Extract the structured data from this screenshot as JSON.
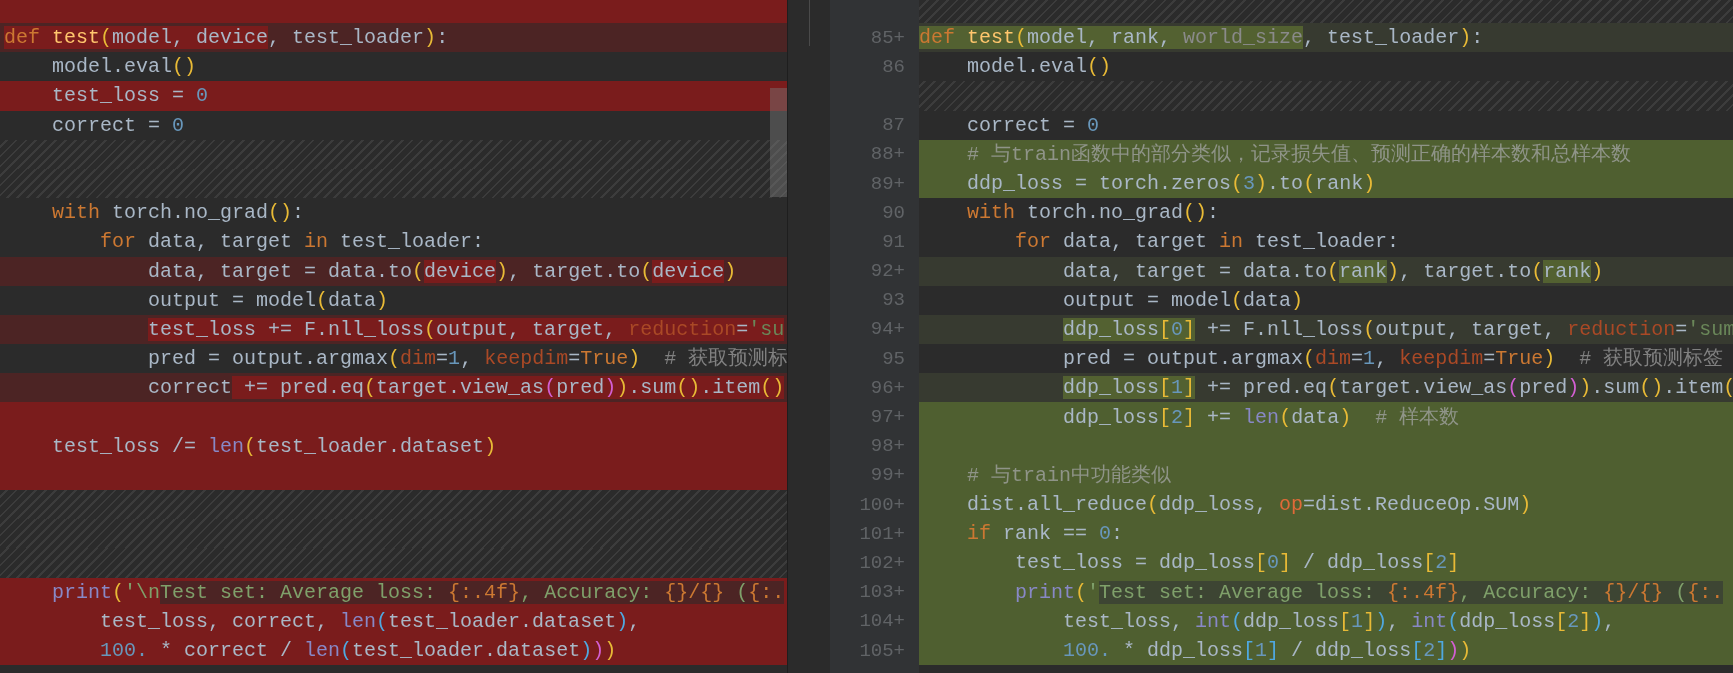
{
  "left_pane": {
    "rows": [
      {
        "kind": "deleted"
      },
      {
        "kind": "modified",
        "parts": [
          {
            "changed": true,
            "tokens": [
              {
                "text": "def ",
                "kind": "kw"
              },
              {
                "text": "test",
                "kind": "fn"
              },
              {
                "text": "(",
                "kind": "b1"
              },
              {
                "text": "model, device",
                "kind": "p"
              }
            ]
          },
          {
            "changed": false,
            "tokens": [
              {
                "text": ", test_loader",
                "kind": "p"
              },
              {
                "text": ")",
                "kind": "b1"
              },
              {
                "text": ":",
                "kind": "p"
              }
            ]
          }
        ]
      },
      {
        "kind": "unchanged",
        "tokens": [
          {
            "text": "    model.eval",
            "kind": "p"
          },
          {
            "text": "()",
            "kind": "b1"
          }
        ]
      },
      {
        "kind": "deleted",
        "tokens": [
          {
            "text": "    test_loss = ",
            "kind": "p"
          },
          {
            "text": "0",
            "kind": "num"
          }
        ]
      },
      {
        "kind": "unchanged",
        "tokens": [
          {
            "text": "    correct = ",
            "kind": "p"
          },
          {
            "text": "0",
            "kind": "num"
          }
        ]
      },
      {
        "kind": "gap"
      },
      {
        "kind": "gap"
      },
      {
        "kind": "unchanged",
        "tokens": [
          {
            "text": "    with",
            "kind": "kw"
          },
          {
            "text": " torch.no_grad",
            "kind": "p"
          },
          {
            "text": "()",
            "kind": "b1"
          },
          {
            "text": ":",
            "kind": "p"
          }
        ]
      },
      {
        "kind": "unchanged",
        "tokens": [
          {
            "text": "        for",
            "kind": "kw"
          },
          {
            "text": " data, target ",
            "kind": "p"
          },
          {
            "text": "in",
            "kind": "kw"
          },
          {
            "text": " test_loader:",
            "kind": "p"
          }
        ]
      },
      {
        "kind": "modified",
        "parts": [
          {
            "changed": false,
            "tokens": [
              {
                "text": "            data, target = data.to",
                "kind": "p"
              },
              {
                "text": "(",
                "kind": "b1"
              }
            ]
          },
          {
            "changed": true,
            "tokens": [
              {
                "text": "device",
                "kind": "p"
              }
            ]
          },
          {
            "changed": false,
            "tokens": [
              {
                "text": ")",
                "kind": "b1"
              },
              {
                "text": ", target.to",
                "kind": "p"
              },
              {
                "text": "(",
                "kind": "b1"
              }
            ]
          },
          {
            "changed": true,
            "tokens": [
              {
                "text": "device",
                "kind": "p"
              }
            ]
          },
          {
            "changed": false,
            "tokens": [
              {
                "text": ")",
                "kind": "b1"
              }
            ]
          }
        ]
      },
      {
        "kind": "unchanged",
        "tokens": [
          {
            "text": "            output = model",
            "kind": "p"
          },
          {
            "text": "(",
            "kind": "b1"
          },
          {
            "text": "data",
            "kind": "p"
          },
          {
            "text": ")",
            "kind": "b1"
          }
        ]
      },
      {
        "kind": "modified",
        "parts": [
          {
            "changed": true,
            "tokens": [
              {
                "text": "            test_loss += F.nll_loss",
                "kind": "p"
              },
              {
                "text": "(",
                "kind": "b1"
              },
              {
                "text": "output, target, ",
                "kind": "p"
              },
              {
                "text": "reduction",
                "kind": "arg"
              },
              {
                "text": "=",
                "kind": "p"
              },
              {
                "text": "'su",
                "kind": "str"
              }
            ]
          }
        ]
      },
      {
        "kind": "unchanged",
        "tokens": [
          {
            "text": "            pred = output.argmax",
            "kind": "p"
          },
          {
            "text": "(",
            "kind": "b1"
          },
          {
            "text": "dim",
            "kind": "arg"
          },
          {
            "text": "=",
            "kind": "p"
          },
          {
            "text": "1",
            "kind": "num"
          },
          {
            "text": ", ",
            "kind": "p"
          },
          {
            "text": "keepdim",
            "kind": "arg"
          },
          {
            "text": "=",
            "kind": "p"
          },
          {
            "text": "True",
            "kind": "kw"
          },
          {
            "text": ")",
            "kind": "b1"
          },
          {
            "text": "  # 获取预测标",
            "kind": "com"
          }
        ]
      },
      {
        "kind": "modified",
        "parts": [
          {
            "changed": false,
            "tokens": [
              {
                "text": "            correct",
                "kind": "p"
              }
            ]
          },
          {
            "changed": true,
            "tokens": [
              {
                "text": " += pred.eq",
                "kind": "p"
              },
              {
                "text": "(",
                "kind": "b1"
              },
              {
                "text": "target.view_as",
                "kind": "p"
              },
              {
                "text": "(",
                "kind": "b2"
              },
              {
                "text": "pred",
                "kind": "p"
              },
              {
                "text": ")",
                "kind": "b2"
              },
              {
                "text": ")",
                "kind": "b1"
              },
              {
                "text": ".sum",
                "kind": "p"
              },
              {
                "text": "()",
                "kind": "b1"
              },
              {
                "text": ".item",
                "kind": "p"
              },
              {
                "text": "()",
                "kind": "b1"
              }
            ]
          }
        ]
      },
      {
        "kind": "deleted"
      },
      {
        "kind": "deleted",
        "tokens": [
          {
            "text": "    test_loss /= ",
            "kind": "p"
          },
          {
            "text": "len",
            "kind": "bi"
          },
          {
            "text": "(",
            "kind": "b1"
          },
          {
            "text": "test_loader.dataset",
            "kind": "p"
          },
          {
            "text": ")",
            "kind": "b1"
          }
        ]
      },
      {
        "kind": "deleted"
      },
      {
        "kind": "gap"
      },
      {
        "kind": "gap"
      },
      {
        "kind": "gap"
      },
      {
        "kind": "deleted",
        "parts": [
          {
            "changed": false,
            "tokens": [
              {
                "text": "    print",
                "kind": "bi"
              },
              {
                "text": "(",
                "kind": "b1"
              },
              {
                "text": "'\\n",
                "kind": "str"
              }
            ]
          },
          {
            "changed": true,
            "tokens": [
              {
                "text": "Test set: Average loss: ",
                "kind": "str"
              },
              {
                "text": "{:.4f}",
                "kind": "fmt"
              },
              {
                "text": ", Accuracy: ",
                "kind": "str"
              },
              {
                "text": "{}/{}",
                "kind": "fmt"
              },
              {
                "text": " (",
                "kind": "str"
              },
              {
                "text": "{:.",
                "kind": "fmt"
              }
            ]
          }
        ]
      },
      {
        "kind": "deleted",
        "tokens": [
          {
            "text": "        test_loss, correct, ",
            "kind": "p"
          },
          {
            "text": "len",
            "kind": "bi"
          },
          {
            "text": "(",
            "kind": "b3"
          },
          {
            "text": "test_loader.dataset",
            "kind": "p"
          },
          {
            "text": ")",
            "kind": "b3"
          },
          {
            "text": ",",
            "kind": "p"
          }
        ]
      },
      {
        "kind": "deleted",
        "tokens": [
          {
            "text": "        100.",
            "kind": "num"
          },
          {
            "text": " * correct / ",
            "kind": "p"
          },
          {
            "text": "len",
            "kind": "bi"
          },
          {
            "text": "(",
            "kind": "b3"
          },
          {
            "text": "test_loader.dataset",
            "kind": "p"
          },
          {
            "text": ")",
            "kind": "b3"
          },
          {
            "text": ")",
            "kind": "b2"
          },
          {
            "text": ")",
            "kind": "b1"
          }
        ]
      }
    ]
  },
  "right_pane": {
    "rows": [
      {
        "kind": "gap"
      },
      {
        "kind": "modified",
        "number": "85+",
        "parts": [
          {
            "changed": true,
            "tokens": [
              {
                "text": "def ",
                "kind": "kw"
              },
              {
                "text": "test",
                "kind": "fn"
              },
              {
                "text": "(",
                "kind": "b1"
              },
              {
                "text": "model, rank, ",
                "kind": "p"
              },
              {
                "text": "world_size",
                "kind": "unused"
              }
            ]
          },
          {
            "changed": false,
            "tokens": [
              {
                "text": ", test_loader",
                "kind": "p"
              },
              {
                "text": ")",
                "kind": "b1"
              },
              {
                "text": ":",
                "kind": "p"
              }
            ]
          }
        ]
      },
      {
        "kind": "unchanged",
        "number": "86",
        "tokens": [
          {
            "text": "    model.eval",
            "kind": "p"
          },
          {
            "text": "()",
            "kind": "b1"
          }
        ]
      },
      {
        "kind": "gap"
      },
      {
        "kind": "unchanged",
        "number": "87",
        "tokens": [
          {
            "text": "    correct = ",
            "kind": "p"
          },
          {
            "text": "0",
            "kind": "num"
          }
        ]
      },
      {
        "kind": "inserted",
        "number": "88+",
        "tokens": [
          {
            "text": "    # 与train函数中的部分类似，记录损失值、预测正确的样本数和总样本数",
            "kind": "com"
          }
        ]
      },
      {
        "kind": "inserted",
        "number": "89+",
        "tokens": [
          {
            "text": "    ddp_loss = torch.zeros",
            "kind": "p"
          },
          {
            "text": "(",
            "kind": "b1"
          },
          {
            "text": "3",
            "kind": "num"
          },
          {
            "text": ")",
            "kind": "b1"
          },
          {
            "text": ".to",
            "kind": "p"
          },
          {
            "text": "(",
            "kind": "b1"
          },
          {
            "text": "rank",
            "kind": "p"
          },
          {
            "text": ")",
            "kind": "b1"
          }
        ]
      },
      {
        "kind": "unchanged",
        "number": "90",
        "tokens": [
          {
            "text": "    with",
            "kind": "kw"
          },
          {
            "text": " torch.no_grad",
            "kind": "p"
          },
          {
            "text": "()",
            "kind": "b1"
          },
          {
            "text": ":",
            "kind": "p"
          }
        ]
      },
      {
        "kind": "unchanged",
        "number": "91",
        "tokens": [
          {
            "text": "        for",
            "kind": "kw"
          },
          {
            "text": " data, target ",
            "kind": "p"
          },
          {
            "text": "in",
            "kind": "kw"
          },
          {
            "text": " test_loader:",
            "kind": "p"
          }
        ]
      },
      {
        "kind": "modified",
        "number": "92+",
        "parts": [
          {
            "changed": false,
            "tokens": [
              {
                "text": "            data, target = data.to",
                "kind": "p"
              },
              {
                "text": "(",
                "kind": "b1"
              }
            ]
          },
          {
            "changed": true,
            "tokens": [
              {
                "text": "rank",
                "kind": "p"
              }
            ]
          },
          {
            "changed": false,
            "tokens": [
              {
                "text": ")",
                "kind": "b1"
              },
              {
                "text": ", target.to",
                "kind": "p"
              },
              {
                "text": "(",
                "kind": "b1"
              }
            ]
          },
          {
            "changed": true,
            "tokens": [
              {
                "text": "rank",
                "kind": "p"
              }
            ]
          },
          {
            "changed": false,
            "tokens": [
              {
                "text": ")",
                "kind": "b1"
              }
            ]
          }
        ]
      },
      {
        "kind": "unchanged",
        "number": "93",
        "tokens": [
          {
            "text": "            output = model",
            "kind": "p"
          },
          {
            "text": "(",
            "kind": "b1"
          },
          {
            "text": "data",
            "kind": "p"
          },
          {
            "text": ")",
            "kind": "b1"
          }
        ]
      },
      {
        "kind": "modified",
        "number": "94+",
        "parts": [
          {
            "changed": true,
            "tokens": [
              {
                "text": "            ddp_loss",
                "kind": "p"
              },
              {
                "text": "[",
                "kind": "b1"
              },
              {
                "text": "0",
                "kind": "num"
              },
              {
                "text": "]",
                "kind": "b1"
              }
            ]
          },
          {
            "changed": false,
            "tokens": [
              {
                "text": " += F.nll_loss",
                "kind": "p"
              },
              {
                "text": "(",
                "kind": "b1"
              },
              {
                "text": "output, target, ",
                "kind": "p"
              },
              {
                "text": "reduction",
                "kind": "arg"
              },
              {
                "text": "=",
                "kind": "p"
              },
              {
                "text": "'sum",
                "kind": "str"
              }
            ]
          }
        ]
      },
      {
        "kind": "unchanged",
        "number": "95",
        "tokens": [
          {
            "text": "            pred = output.argmax",
            "kind": "p"
          },
          {
            "text": "(",
            "kind": "b1"
          },
          {
            "text": "dim",
            "kind": "arg"
          },
          {
            "text": "=",
            "kind": "p"
          },
          {
            "text": "1",
            "kind": "num"
          },
          {
            "text": ", ",
            "kind": "p"
          },
          {
            "text": "keepdim",
            "kind": "arg"
          },
          {
            "text": "=",
            "kind": "p"
          },
          {
            "text": "True",
            "kind": "kw"
          },
          {
            "text": ")",
            "kind": "b1"
          },
          {
            "text": "  # 获取预测标签",
            "kind": "com"
          }
        ]
      },
      {
        "kind": "modified",
        "number": "96+",
        "parts": [
          {
            "changed": true,
            "tokens": [
              {
                "text": "            ddp_loss",
                "kind": "p"
              },
              {
                "text": "[",
                "kind": "b1"
              },
              {
                "text": "1",
                "kind": "num"
              },
              {
                "text": "]",
                "kind": "b1"
              }
            ]
          },
          {
            "changed": false,
            "tokens": [
              {
                "text": " += pred.eq",
                "kind": "p"
              },
              {
                "text": "(",
                "kind": "b1"
              },
              {
                "text": "target.view_as",
                "kind": "p"
              },
              {
                "text": "(",
                "kind": "b2"
              },
              {
                "text": "pred",
                "kind": "p"
              },
              {
                "text": ")",
                "kind": "b2"
              },
              {
                "text": ")",
                "kind": "b1"
              },
              {
                "text": ".sum",
                "kind": "p"
              },
              {
                "text": "()",
                "kind": "b1"
              },
              {
                "text": ".item",
                "kind": "p"
              },
              {
                "text": "(",
                "kind": "b1"
              }
            ]
          }
        ]
      },
      {
        "kind": "inserted",
        "number": "97+",
        "tokens": [
          {
            "text": "            ddp_loss",
            "kind": "p"
          },
          {
            "text": "[",
            "kind": "b1"
          },
          {
            "text": "2",
            "kind": "num"
          },
          {
            "text": "]",
            "kind": "b1"
          },
          {
            "text": " += ",
            "kind": "p"
          },
          {
            "text": "len",
            "kind": "bi"
          },
          {
            "text": "(",
            "kind": "b1"
          },
          {
            "text": "data",
            "kind": "p"
          },
          {
            "text": ")",
            "kind": "b1"
          },
          {
            "text": "  # 样本数",
            "kind": "com"
          }
        ]
      },
      {
        "kind": "inserted",
        "number": "98+"
      },
      {
        "kind": "inserted",
        "number": "99+",
        "tokens": [
          {
            "text": "    # 与train中功能类似",
            "kind": "com"
          }
        ]
      },
      {
        "kind": "inserted",
        "number": "100+",
        "tokens": [
          {
            "text": "    dist.all_reduce",
            "kind": "p"
          },
          {
            "text": "(",
            "kind": "b1"
          },
          {
            "text": "ddp_loss, ",
            "kind": "p"
          },
          {
            "text": "op",
            "kind": "arg"
          },
          {
            "text": "=dist.ReduceOp.SUM",
            "kind": "p"
          },
          {
            "text": ")",
            "kind": "b1"
          }
        ]
      },
      {
        "kind": "inserted",
        "number": "101+",
        "tokens": [
          {
            "text": "    if",
            "kind": "kw"
          },
          {
            "text": " rank == ",
            "kind": "p"
          },
          {
            "text": "0",
            "kind": "num"
          },
          {
            "text": ":",
            "kind": "p"
          }
        ]
      },
      {
        "kind": "inserted",
        "number": "102+",
        "tokens": [
          {
            "text": "        test_loss = ddp_loss",
            "kind": "p"
          },
          {
            "text": "[",
            "kind": "b1"
          },
          {
            "text": "0",
            "kind": "num"
          },
          {
            "text": "]",
            "kind": "b1"
          },
          {
            "text": " / ddp_loss",
            "kind": "p"
          },
          {
            "text": "[",
            "kind": "b1"
          },
          {
            "text": "2",
            "kind": "num"
          },
          {
            "text": "]",
            "kind": "b1"
          }
        ]
      },
      {
        "kind": "inserted",
        "number": "103+",
        "parts": [
          {
            "changed": false,
            "tokens": [
              {
                "text": "        print",
                "kind": "bi"
              },
              {
                "text": "(",
                "kind": "b1"
              },
              {
                "text": "'",
                "kind": "str"
              }
            ]
          },
          {
            "changed": true,
            "tokens": [
              {
                "text": "Test set: Average loss: ",
                "kind": "str"
              },
              {
                "text": "{:.4f}",
                "kind": "fmt"
              },
              {
                "text": ", Accuracy: ",
                "kind": "str"
              },
              {
                "text": "{}/{}",
                "kind": "fmt"
              },
              {
                "text": " (",
                "kind": "str"
              },
              {
                "text": "{:.",
                "kind": "fmt"
              }
            ]
          }
        ]
      },
      {
        "kind": "inserted",
        "number": "104+",
        "tokens": [
          {
            "text": "            test_loss, ",
            "kind": "p"
          },
          {
            "text": "int",
            "kind": "bi"
          },
          {
            "text": "(",
            "kind": "b3"
          },
          {
            "text": "ddp_loss",
            "kind": "p"
          },
          {
            "text": "[",
            "kind": "b1"
          },
          {
            "text": "1",
            "kind": "num"
          },
          {
            "text": "]",
            "kind": "b1"
          },
          {
            "text": ")",
            "kind": "b3"
          },
          {
            "text": ", ",
            "kind": "p"
          },
          {
            "text": "int",
            "kind": "bi"
          },
          {
            "text": "(",
            "kind": "b3"
          },
          {
            "text": "ddp_loss",
            "kind": "p"
          },
          {
            "text": "[",
            "kind": "b1"
          },
          {
            "text": "2",
            "kind": "num"
          },
          {
            "text": "]",
            "kind": "b1"
          },
          {
            "text": ")",
            "kind": "b3"
          },
          {
            "text": ",",
            "kind": "p"
          }
        ]
      },
      {
        "kind": "inserted",
        "number": "105+",
        "tokens": [
          {
            "text": "            100.",
            "kind": "num"
          },
          {
            "text": " * ddp_loss",
            "kind": "p"
          },
          {
            "text": "[",
            "kind": "b3"
          },
          {
            "text": "1",
            "kind": "num"
          },
          {
            "text": "]",
            "kind": "b3"
          },
          {
            "text": " / ddp_loss",
            "kind": "p"
          },
          {
            "text": "[",
            "kind": "b3"
          },
          {
            "text": "2",
            "kind": "num"
          },
          {
            "text": "]",
            "kind": "b3"
          },
          {
            "text": ")",
            "kind": "b2"
          },
          {
            "text": ")",
            "kind": "b1"
          }
        ]
      }
    ]
  }
}
